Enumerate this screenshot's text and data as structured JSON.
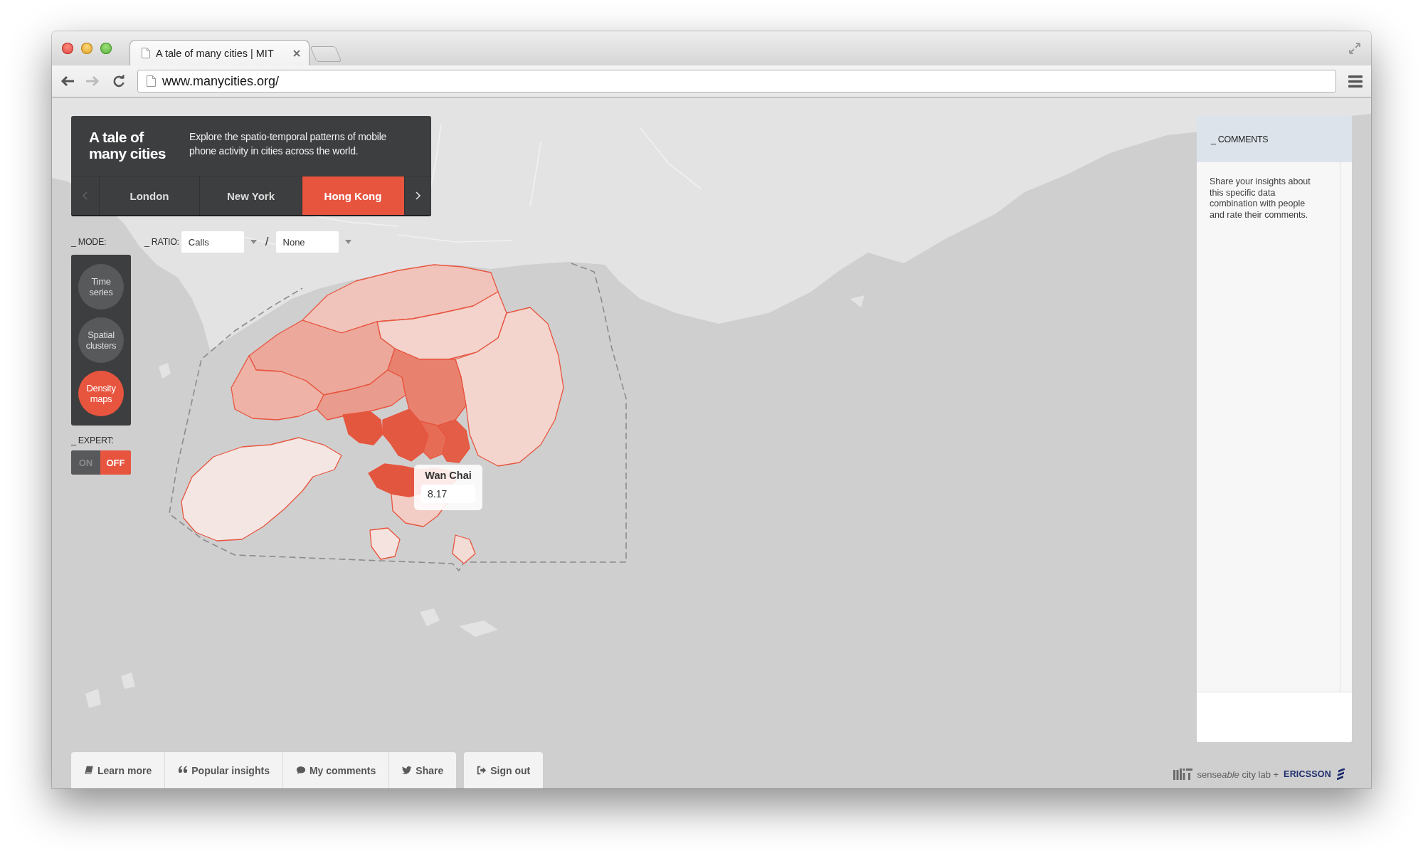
{
  "browser": {
    "tab_title": "A tale of many cities | MIT",
    "url": "www.manycities.org/",
    "back_enabled": true,
    "forward_enabled": false
  },
  "header": {
    "title": "A tale of many cities",
    "description": "Explore the spatio-temporal patterns of mobile phone activity in cities across the world."
  },
  "city_pager": {
    "previous_enabled": false,
    "next_enabled": true
  },
  "city_tabs": [
    {
      "label": "London",
      "selected": false
    },
    {
      "label": "New York",
      "selected": false
    },
    {
      "label": "Hong Kong",
      "selected": true
    }
  ],
  "mode": {
    "label": "_ MODE:",
    "options": [
      {
        "label": "Time series",
        "selected": false
      },
      {
        "label": "Spatial clusters",
        "selected": false
      },
      {
        "label": "Density maps",
        "selected": true
      }
    ]
  },
  "ratio": {
    "label": "_ RATIO:",
    "numerator": "Calls",
    "separator": "/",
    "denominator": "None"
  },
  "expert": {
    "label": "_ EXPERT:",
    "on_label": "ON",
    "off_label": "OFF",
    "on": false
  },
  "map": {
    "tooltip": {
      "title": "Wan Chai",
      "value": "8.17"
    }
  },
  "comments": {
    "title": "_ COMMENTS",
    "text": "Share your insights about this specific data combination with people and rate their comments."
  },
  "footer": {
    "buttons": [
      {
        "kind": "learn",
        "label": "Learn more"
      },
      {
        "kind": "popular",
        "label": "Popular insights"
      },
      {
        "kind": "comments",
        "label": "My comments"
      },
      {
        "kind": "share",
        "label": "Share"
      }
    ],
    "sign_out": {
      "label": "Sign out"
    }
  },
  "credits": {
    "lab_parts": [
      {
        "text": "sense",
        "italic": false
      },
      {
        "text": "able",
        "italic": true
      },
      {
        "text": " city lab +",
        "italic": false
      }
    ],
    "partner": "ERICSSON"
  }
}
